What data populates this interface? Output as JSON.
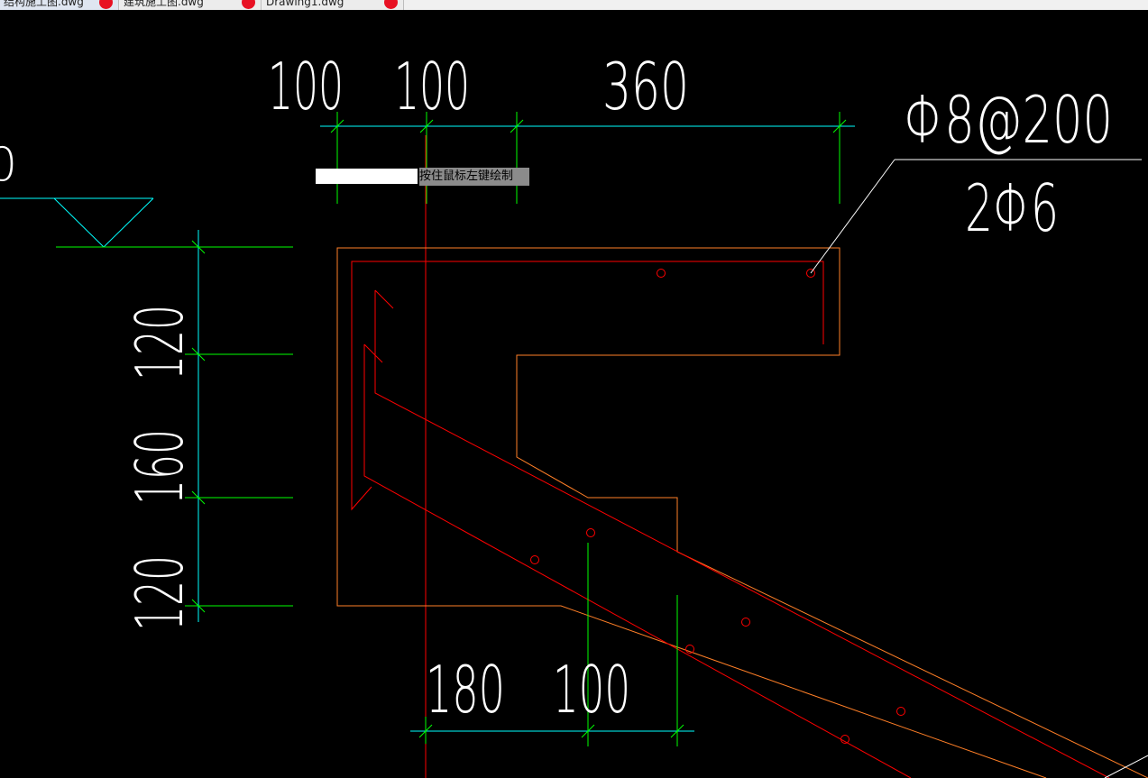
{
  "tabs": [
    {
      "label": "结构施工图.dwg",
      "active": true
    },
    {
      "label": "建筑施工图.dwg",
      "active": false
    },
    {
      "label": "Drawing1.dwg",
      "active": false
    }
  ],
  "drawing": {
    "dims_top": [
      "100",
      "100",
      "360"
    ],
    "dims_left": [
      "120",
      "160",
      "120"
    ],
    "dims_bottom": [
      "180",
      "100"
    ],
    "rebar_label_top": "Φ8@200",
    "rebar_label_bottom": "2Φ6",
    "partial_left_text": "0"
  },
  "tooltip": {
    "text": "按住鼠标左键绘制"
  },
  "colors": {
    "background": "#000000",
    "dimension_line": "#00ff00",
    "dimension_cyan": "#00ffff",
    "concrete_outline": "#ff7f27",
    "rebar": "#ff0000",
    "text": "#ffffff"
  }
}
